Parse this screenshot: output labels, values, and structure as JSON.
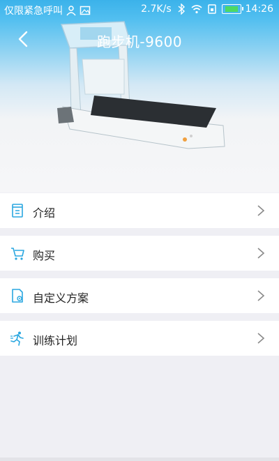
{
  "status_bar": {
    "carrier": "仅限紧急呼叫",
    "speed": "2.7K/s",
    "time": "14:26",
    "icons": [
      "person-icon",
      "image-icon",
      "bluetooth-icon",
      "wifi-icon",
      "sim-icon",
      "battery-icon"
    ]
  },
  "header": {
    "title": "跑步机-9600",
    "back_icon": "chevron-left-icon"
  },
  "menu": {
    "items": [
      {
        "label": "介绍",
        "icon": "document-icon"
      },
      {
        "label": "购买",
        "icon": "cart-icon"
      },
      {
        "label": "自定义方案",
        "icon": "settings-file-icon"
      },
      {
        "label": "训练计划",
        "icon": "runner-icon"
      }
    ]
  },
  "colors": {
    "accent": "#3bb2ea",
    "icon": "#2aa7e0",
    "background": "#efeff4"
  }
}
